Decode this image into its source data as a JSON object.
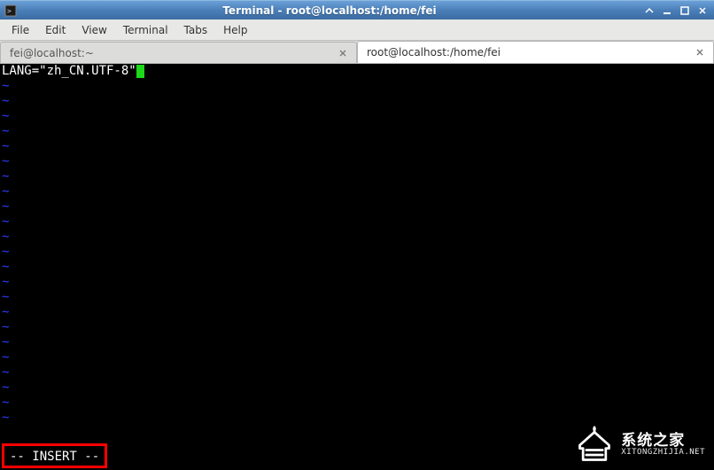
{
  "window": {
    "title": "Terminal - root@localhost:/home/fei"
  },
  "menubar": {
    "items": [
      "File",
      "Edit",
      "View",
      "Terminal",
      "Tabs",
      "Help"
    ]
  },
  "tabs": [
    {
      "label": "fei@localhost:~",
      "active": false
    },
    {
      "label": "root@localhost:/home/fei",
      "active": true
    }
  ],
  "editor": {
    "first_line": "LANG=\"zh_CN.UTF-8\"",
    "tilde": "~",
    "status_mode": "-- INSERT --"
  },
  "watermark": {
    "main": "系统之家",
    "sub": "XITONGZHIJIA.NET"
  }
}
